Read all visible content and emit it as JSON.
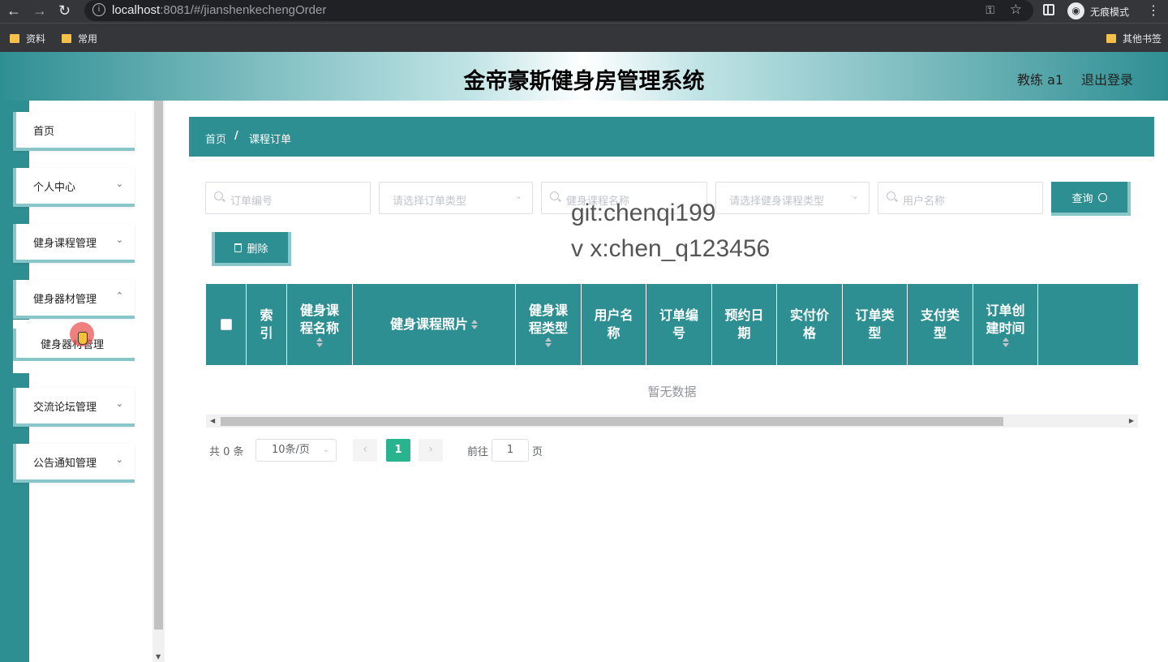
{
  "browser": {
    "url_host": "localhost",
    "url_rest": ":8081/#/jianshenkechengOrder",
    "incognito_label": "无痕模式",
    "bookmarks": [
      "资料",
      "常用"
    ],
    "other_bookmarks": "其他书签"
  },
  "header": {
    "title": "金帝豪斯健身房管理系统",
    "user_role": "教练 a1",
    "logout": "退出登录"
  },
  "sidebar": {
    "items": [
      {
        "label": "首页"
      },
      {
        "label": "个人中心"
      },
      {
        "label": "健身课程管理"
      },
      {
        "label": "健身器材管理"
      },
      {
        "label": "交流论坛管理"
      },
      {
        "label": "公告通知管理"
      }
    ],
    "submenu": {
      "label": "健身器材管理"
    }
  },
  "breadcrumb": {
    "home": "首页",
    "separator": "/",
    "current": "课程订单"
  },
  "search": {
    "order_no_placeholder": "订单编号",
    "order_type_placeholder": "请选择订单类型",
    "course_name_placeholder": "健身课程名称",
    "course_type_placeholder": "请选择健身课程类型",
    "user_name_placeholder": "用户名称",
    "query_label": "查询"
  },
  "actions": {
    "delete_label": "删除"
  },
  "watermark": {
    "line1": "git:chenqi199",
    "line2": "v x:chen_q123456"
  },
  "table": {
    "columns": [
      {
        "label": "索\n引",
        "sortable": false
      },
      {
        "label": "健身课\n程名称",
        "sortable": true
      },
      {
        "label": "健身课程照片",
        "sortable": true
      },
      {
        "label": "健身课\n程类型",
        "sortable": true
      },
      {
        "label": "用户名\n称",
        "sortable": true
      },
      {
        "label": "订单编\n号",
        "sortable": true
      },
      {
        "label": "预约日\n期",
        "sortable": true
      },
      {
        "label": "实付价\n格",
        "sortable": true
      },
      {
        "label": "订单类\n型",
        "sortable": true
      },
      {
        "label": "支付类\n型",
        "sortable": true
      },
      {
        "label": "订单创\n建时间",
        "sortable": true
      },
      {
        "label": "",
        "sortable": false
      }
    ],
    "empty_text": "暂无数据"
  },
  "pagination": {
    "total": "共 0 条",
    "page_size": "10条/页",
    "prev": "‹",
    "current": "1",
    "next": "›",
    "goto_label": "前往",
    "goto_value": "1",
    "page_label": "页"
  },
  "colors": {
    "accent": "#2e8f93",
    "accent_light": "#88c6ca",
    "page_active": "#2ab38f"
  }
}
